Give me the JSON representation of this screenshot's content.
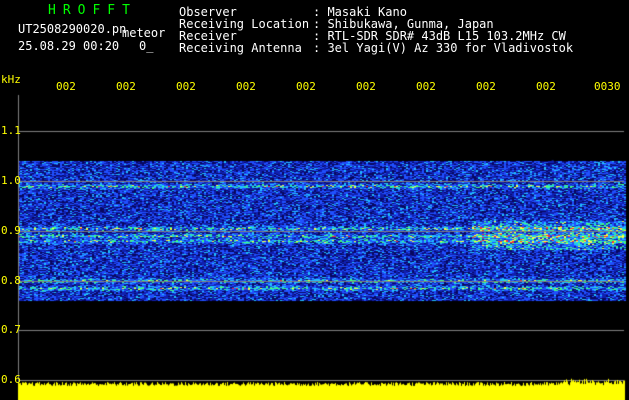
{
  "header": {
    "app_name": "HROFFT",
    "file_name": "UT2508290020.pn",
    "mode": "meteor",
    "datetime": "25.08.29 00:20",
    "counter": "0_",
    "observer_label": "Observer",
    "observer_value": ": Masaki Kano",
    "location_label": "Receiving Location",
    "location_value": ": Shibukawa, Gunma, Japan",
    "receiver_label": "Receiver",
    "receiver_value": ": RTL-SDR SDR# 43dB L15 103.2MHz CW",
    "antenna_label": "Receiving Antenna",
    "antenna_value": ": 3el Yagi(V) Az 330 for Vladivostok"
  },
  "axis": {
    "unit": "kHz",
    "y_ticks": [
      "1.1",
      "1.0",
      "0.9",
      "0.8",
      "0.7",
      "0.6"
    ],
    "x_ticks": [
      "002",
      "002",
      "002",
      "002",
      "002",
      "002",
      "002",
      "002",
      "002",
      "0030"
    ]
  },
  "colors": {
    "background": "#000000",
    "header_text": "#ffffff",
    "app_name": "#00ff00",
    "axis_text": "#ffff00",
    "grid": "#808080",
    "signal_bar": "#ffff00"
  },
  "spectrogram": {
    "band_top_khz": 1.04,
    "band_bottom_khz": 0.76,
    "strong_lines_khz": [
      0.99,
      0.905,
      0.89,
      0.88,
      0.8,
      0.785
    ]
  }
}
